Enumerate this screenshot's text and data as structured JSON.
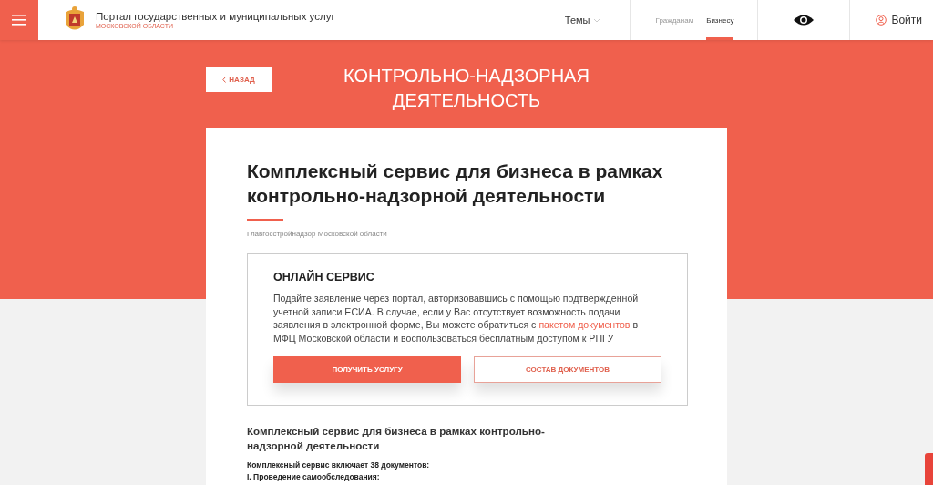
{
  "header": {
    "title": "Портал государственных и муниципальных услуг",
    "subtitle": "МОСКОВСКОЙ ОБЛАСТИ",
    "topics": "Темы",
    "audience_tabs": [
      {
        "label": "Гражданам",
        "selected": false
      },
      {
        "label": "Бизнесу",
        "selected": true
      }
    ],
    "login": "Войти"
  },
  "hero": {
    "back": "НАЗАД",
    "title": "КОНТРОЛЬНО-НАДЗОРНАЯ ДЕЯТЕЛЬНОСТЬ"
  },
  "card": {
    "title": "Комплексный сервис для бизнеса в рамках контрольно-надзорной деятельности",
    "agency": "Главгосстройнадзор Московской области",
    "online": {
      "heading": "ОНЛАЙН СЕРВИС",
      "text_before": "Подайте заявление через портал, авторизовавшись с помощью подтвержденной учетной записи ЕСИА. В случае, если у Вас отсутствует возможность подачи заявления в электронной форме, Вы можете обратиться с",
      "link": "пакетом документов",
      "text_after": "в МФЦ Московской области и воспользоваться бесплатным доступом к РПГУ",
      "buttons": [
        {
          "label": "ПОЛУЧИТЬ УСЛУГУ",
          "kind": "primary"
        },
        {
          "label": "СОСТАВ ДОКУМЕНТОВ",
          "kind": "outline"
        }
      ]
    },
    "description_title": "Комплексный сервис для бизнеса в рамках контрольно-надзорной деятельности",
    "lines": [
      "Комплексный сервис включает 38 документов:",
      "I. Проведение самообследования:"
    ]
  }
}
